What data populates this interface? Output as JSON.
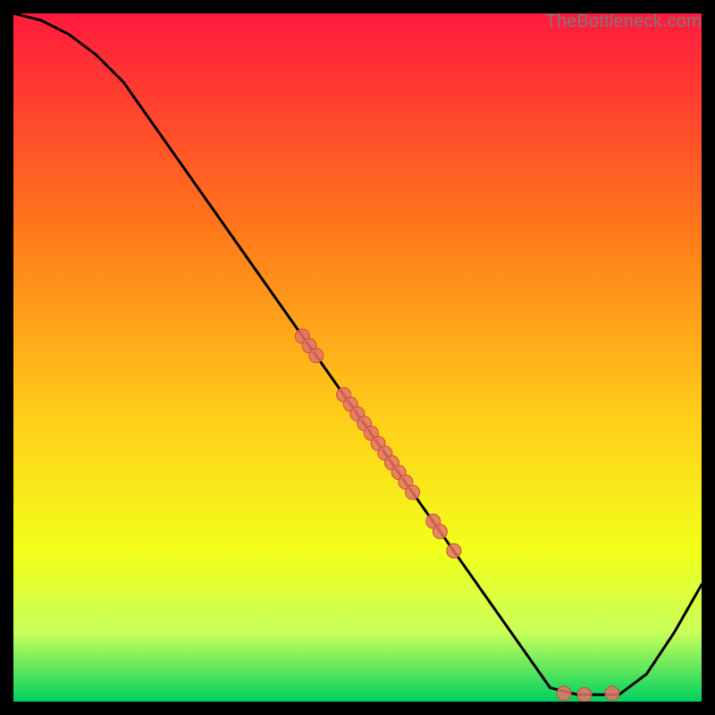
{
  "watermark": "TheBottleneck.com",
  "colors": {
    "gradient_top": "#ff1a3d",
    "gradient_mid_upper": "#ff7a1a",
    "gradient_mid": "#ffd21a",
    "gradient_mid_lower": "#f2ff1a",
    "gradient_low": "#c8ff5a",
    "gradient_bottom": "#00d060",
    "curve": "#000000",
    "dot_fill": "#e57368",
    "dot_stroke": "#c94d42"
  },
  "chart_data": {
    "type": "line",
    "title": "",
    "xlabel": "",
    "ylabel": "",
    "xlim": [
      0,
      100
    ],
    "ylim": [
      0,
      100
    ],
    "grid": false,
    "legend": false,
    "series": [
      {
        "name": "curve",
        "x": [
          0,
          4,
          8,
          12,
          16,
          78,
          82,
          88,
          92,
          96,
          100
        ],
        "y": [
          100,
          99,
          97,
          94,
          90,
          2,
          1,
          1,
          4,
          10,
          17
        ]
      }
    ],
    "scatter": [
      {
        "name": "dots-on-curve",
        "points": [
          {
            "x": 42,
            "y": 53.1
          },
          {
            "x": 43,
            "y": 51.7
          },
          {
            "x": 44,
            "y": 50.3
          },
          {
            "x": 48,
            "y": 44.6
          },
          {
            "x": 49,
            "y": 43.2
          },
          {
            "x": 50,
            "y": 41.8
          },
          {
            "x": 51,
            "y": 40.4
          },
          {
            "x": 52,
            "y": 39.0
          },
          {
            "x": 53,
            "y": 37.5
          },
          {
            "x": 54,
            "y": 36.1
          },
          {
            "x": 55,
            "y": 34.7
          },
          {
            "x": 56,
            "y": 33.3
          },
          {
            "x": 57,
            "y": 31.9
          },
          {
            "x": 58,
            "y": 30.4
          },
          {
            "x": 61,
            "y": 26.2
          },
          {
            "x": 62,
            "y": 24.7
          },
          {
            "x": 64,
            "y": 21.9
          },
          {
            "x": 80,
            "y": 1.2
          },
          {
            "x": 83,
            "y": 1.0
          },
          {
            "x": 87,
            "y": 1.2
          }
        ]
      }
    ]
  }
}
